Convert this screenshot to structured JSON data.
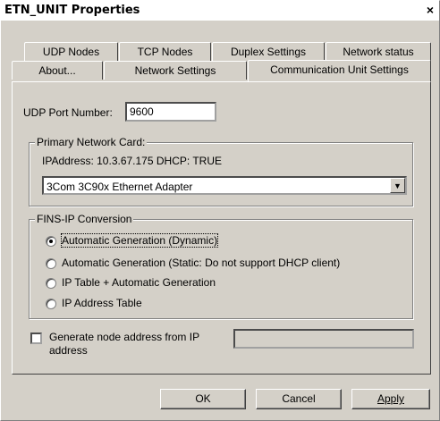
{
  "window": {
    "title": "ETN_UNIT Properties",
    "close_glyph": "×"
  },
  "tabs": {
    "row1": [
      "UDP Nodes",
      "TCP Nodes",
      "Duplex Settings",
      "Network status"
    ],
    "row2": [
      "About...",
      "Network Settings",
      "Communication Unit Settings"
    ],
    "active": "Communication Unit Settings"
  },
  "udp": {
    "label": "UDP Port Number:",
    "value": "9600"
  },
  "primary_card": {
    "title": "Primary Network Card:",
    "info": "IPAddress: 10.3.67.175   DHCP: TRUE",
    "selected": "3Com 3C90x Ethernet Adapter"
  },
  "fins": {
    "title": "FINS-IP Conversion",
    "options": [
      "Automatic Generation (Dynamic)",
      "Automatic Generation (Static: Do not support DHCP client)",
      "IP Table + Automatic Generation",
      "IP Address Table"
    ],
    "selected_index": 0
  },
  "generate": {
    "label_line1": "Generate node address from IP",
    "label_line2": "address",
    "checked": false,
    "value": ""
  },
  "buttons": {
    "ok": "OK",
    "cancel": "Cancel",
    "apply": "Apply"
  }
}
